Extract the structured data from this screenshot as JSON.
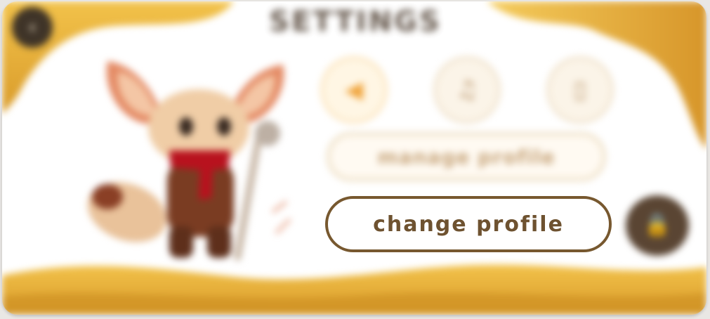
{
  "screen": {
    "title": "SETTINGS",
    "back_icon": "back-arrow-icon"
  },
  "settings_toggles": [
    {
      "name": "sound",
      "icon": "speaker-icon",
      "glyph": "◀"
    },
    {
      "name": "music",
      "icon": "music-note-icon",
      "glyph": "♫"
    },
    {
      "name": "vibration",
      "icon": "vibrate-phone-icon",
      "glyph": "▯"
    }
  ],
  "buttons": {
    "manage_profile": "manage profile",
    "change_profile": "change profile",
    "lock_icon": "lock-icon",
    "lock_glyph": "🔒"
  },
  "character": {
    "description_icon": "fennec-fox-mascot"
  },
  "colors": {
    "accent_gold": "#e3b13f",
    "button_border_brown": "#77582f",
    "button_text_brown": "#6e5230",
    "dark_circle": "#5a4533"
  }
}
